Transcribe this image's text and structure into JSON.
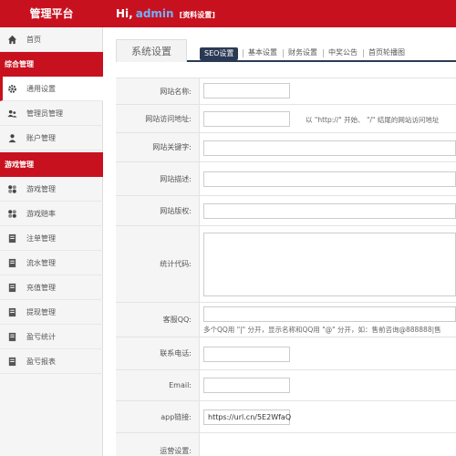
{
  "header": {
    "brand": "管理平台",
    "greeting_prefix": "Hi,",
    "username": "admin",
    "profile_link": "[资料设置]"
  },
  "sidebar": {
    "home": "首页",
    "group1": "综合管理",
    "items1": [
      "通用设置",
      "管理员管理",
      "账户管理"
    ],
    "group2": "游戏管理",
    "items2": [
      "游戏管理",
      "游戏赔率",
      "注单管理",
      "流水管理",
      "充值管理",
      "提现管理",
      "盈亏统计",
      "盈亏报表"
    ]
  },
  "main": {
    "section_title": "系统设置",
    "tabs": [
      "SEO设置",
      "基本设置",
      "财务设置",
      "中奖公告",
      "首页轮播图"
    ],
    "active_tab": "SEO设置"
  },
  "form": {
    "site_name_label": "网站名称:",
    "site_url_label": "网站访问地址:",
    "site_url_hint": "以 \"http://\" 开始、 \"/\" 结尾的网站访问地址",
    "keywords_label": "网站关键字:",
    "desc_label": "网站描述:",
    "copyright_label": "网站版权:",
    "stats_label": "统计代码:",
    "qq_label": "客服QQ:",
    "qq_hint": "多个QQ用 \"|\" 分开，显示名称和QQ用 \"@\" 分开，如：售前咨询@888888|售",
    "phone_label": "联系电话:",
    "email_label": "Email:",
    "app_label": "app链接:",
    "app_value": "https://url.cn/5E2WfaQ",
    "last_label": "运营设置:"
  },
  "colors": {
    "brand_red": "#c8111f",
    "tab_active": "#2a3a55",
    "username_blue": "#6fb2ff"
  }
}
